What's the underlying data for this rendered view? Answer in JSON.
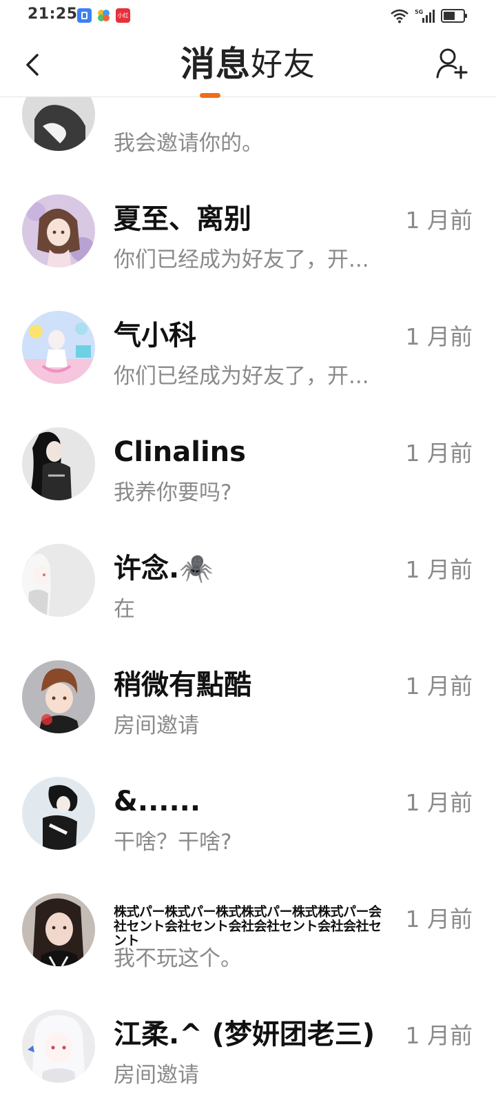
{
  "status_bar": {
    "time": "21:25",
    "notif_icons": [
      "app-notification-icon",
      "pinwheel-icon",
      "xiaohongshu-icon"
    ],
    "notif_label_3": "小红书",
    "network": "5G"
  },
  "header": {
    "tabs": [
      {
        "label": "消息",
        "active": true
      },
      {
        "label": "好友",
        "active": false
      }
    ],
    "accent_color": "#f26b1d"
  },
  "conversations": [
    {
      "name": "",
      "message": "我会邀请你的。",
      "time": ""
    },
    {
      "name": "夏至、离别",
      "message": "你们已经成为好友了，开...",
      "time": "1 月前"
    },
    {
      "name": "气小科",
      "message": "你们已经成为好友了，开...",
      "time": "1 月前"
    },
    {
      "name": "Clinalins",
      "message": "我养你要吗?",
      "time": "1 月前"
    },
    {
      "name": "许念.🕷️",
      "message": "在",
      "time": "1 月前"
    },
    {
      "name": "稍微有點酷",
      "message": "房间邀请",
      "time": "1 月前"
    },
    {
      "name": "&......",
      "message": "干啥？干啥?",
      "time": "1 月前"
    },
    {
      "name": "株式パー株式パー株式株式パー株式株式パー会社セント会社セント会社会社セント会社会社セント",
      "message": "我不玩这个。",
      "time": "1 月前"
    },
    {
      "name": "江柔.^ (梦妍团老三)",
      "message": "房间邀请",
      "time": "1 月前"
    }
  ]
}
